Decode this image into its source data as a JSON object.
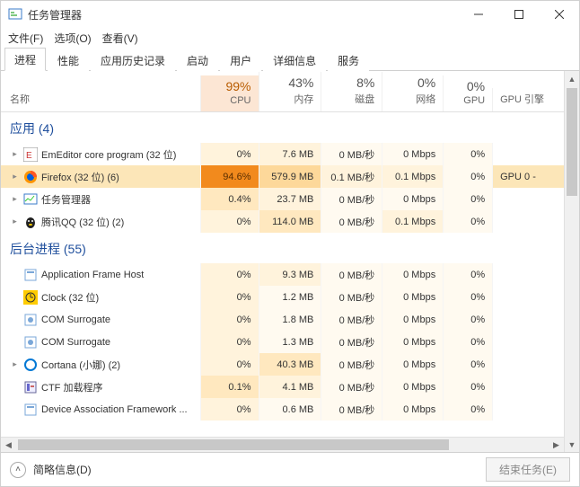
{
  "window": {
    "title": "任务管理器"
  },
  "menu": {
    "file": "文件(F)",
    "options": "选项(O)",
    "view": "查看(V)"
  },
  "tabs": {
    "processes": "进程",
    "performance": "性能",
    "history": "应用历史记录",
    "startup": "启动",
    "users": "用户",
    "details": "详细信息",
    "services": "服务"
  },
  "headers": {
    "name": "名称",
    "cpu": {
      "pct": "99%",
      "label": "CPU"
    },
    "mem": {
      "pct": "43%",
      "label": "内存"
    },
    "disk": {
      "pct": "8%",
      "label": "磁盘"
    },
    "net": {
      "pct": "0%",
      "label": "网络"
    },
    "gpu": {
      "pct": "0%",
      "label": "GPU"
    },
    "gpue": {
      "label": "GPU 引擎"
    }
  },
  "groups": {
    "apps": {
      "label": "应用",
      "count": "(4)"
    },
    "bg": {
      "label": "后台进程",
      "count": "(55)"
    }
  },
  "rows": [
    {
      "group": "apps",
      "expandable": true,
      "icon": "emeditor",
      "name": "EmEditor core program (32 位)",
      "cpu": "0%",
      "cpuHeat": 1,
      "mem": "7.6 MB",
      "memHeat": 1,
      "disk": "0 MB/秒",
      "diskHeat": 0,
      "net": "0 Mbps",
      "netHeat": 0,
      "gpu": "0%",
      "gpuHeat": 0,
      "gpue": ""
    },
    {
      "group": "apps",
      "expandable": true,
      "icon": "firefox",
      "name": "Firefox (32 位) (6)",
      "selected": true,
      "cpu": "94.6%",
      "cpuHeat": 5,
      "mem": "579.9 MB",
      "memHeat": 3,
      "disk": "0.1 MB/秒",
      "diskHeat": 1,
      "net": "0.1 Mbps",
      "netHeat": 1,
      "gpu": "0%",
      "gpuHeat": 0,
      "gpue": "GPU 0 -"
    },
    {
      "group": "apps",
      "expandable": true,
      "icon": "taskmgr",
      "name": "任务管理器",
      "cpu": "0.4%",
      "cpuHeat": 2,
      "mem": "23.7 MB",
      "memHeat": 1,
      "disk": "0 MB/秒",
      "diskHeat": 0,
      "net": "0 Mbps",
      "netHeat": 0,
      "gpu": "0%",
      "gpuHeat": 0,
      "gpue": ""
    },
    {
      "group": "apps",
      "expandable": true,
      "icon": "qq",
      "name": "腾讯QQ (32 位) (2)",
      "cpu": "0%",
      "cpuHeat": 1,
      "mem": "114.0 MB",
      "memHeat": 2,
      "disk": "0 MB/秒",
      "diskHeat": 0,
      "net": "0.1 Mbps",
      "netHeat": 1,
      "gpu": "0%",
      "gpuHeat": 0,
      "gpue": ""
    },
    {
      "group": "bg",
      "expandable": false,
      "icon": "generic",
      "name": "Application Frame Host",
      "cpu": "0%",
      "cpuHeat": 1,
      "mem": "9.3 MB",
      "memHeat": 1,
      "disk": "0 MB/秒",
      "diskHeat": 0,
      "net": "0 Mbps",
      "netHeat": 0,
      "gpu": "0%",
      "gpuHeat": 0,
      "gpue": ""
    },
    {
      "group": "bg",
      "expandable": false,
      "icon": "clock",
      "name": "Clock (32 位)",
      "cpu": "0%",
      "cpuHeat": 1,
      "mem": "1.2 MB",
      "memHeat": 0,
      "disk": "0 MB/秒",
      "diskHeat": 0,
      "net": "0 Mbps",
      "netHeat": 0,
      "gpu": "0%",
      "gpuHeat": 0,
      "gpue": ""
    },
    {
      "group": "bg",
      "expandable": false,
      "icon": "com",
      "name": "COM Surrogate",
      "cpu": "0%",
      "cpuHeat": 1,
      "mem": "1.8 MB",
      "memHeat": 0,
      "disk": "0 MB/秒",
      "diskHeat": 0,
      "net": "0 Mbps",
      "netHeat": 0,
      "gpu": "0%",
      "gpuHeat": 0,
      "gpue": ""
    },
    {
      "group": "bg",
      "expandable": false,
      "icon": "com",
      "name": "COM Surrogate",
      "cpu": "0%",
      "cpuHeat": 1,
      "mem": "1.3 MB",
      "memHeat": 0,
      "disk": "0 MB/秒",
      "diskHeat": 0,
      "net": "0 Mbps",
      "netHeat": 0,
      "gpu": "0%",
      "gpuHeat": 0,
      "gpue": ""
    },
    {
      "group": "bg",
      "expandable": true,
      "icon": "cortana",
      "name": "Cortana (小娜) (2)",
      "cpu": "0%",
      "cpuHeat": 1,
      "mem": "40.3 MB",
      "memHeat": 2,
      "disk": "0 MB/秒",
      "diskHeat": 0,
      "net": "0 Mbps",
      "netHeat": 0,
      "gpu": "0%",
      "gpuHeat": 0,
      "gpue": ""
    },
    {
      "group": "bg",
      "expandable": false,
      "icon": "ctf",
      "name": "CTF 加载程序",
      "cpu": "0.1%",
      "cpuHeat": 2,
      "mem": "4.1 MB",
      "memHeat": 1,
      "disk": "0 MB/秒",
      "diskHeat": 0,
      "net": "0 Mbps",
      "netHeat": 0,
      "gpu": "0%",
      "gpuHeat": 0,
      "gpue": ""
    },
    {
      "group": "bg",
      "expandable": false,
      "icon": "generic",
      "name": "Device Association Framework ...",
      "cpu": "0%",
      "cpuHeat": 1,
      "mem": "0.6 MB",
      "memHeat": 0,
      "disk": "0 MB/秒",
      "diskHeat": 0,
      "net": "0 Mbps",
      "netHeat": 0,
      "gpu": "0%",
      "gpuHeat": 0,
      "gpue": ""
    }
  ],
  "footer": {
    "brief": "简略信息(D)",
    "end": "结束任务(E)"
  }
}
